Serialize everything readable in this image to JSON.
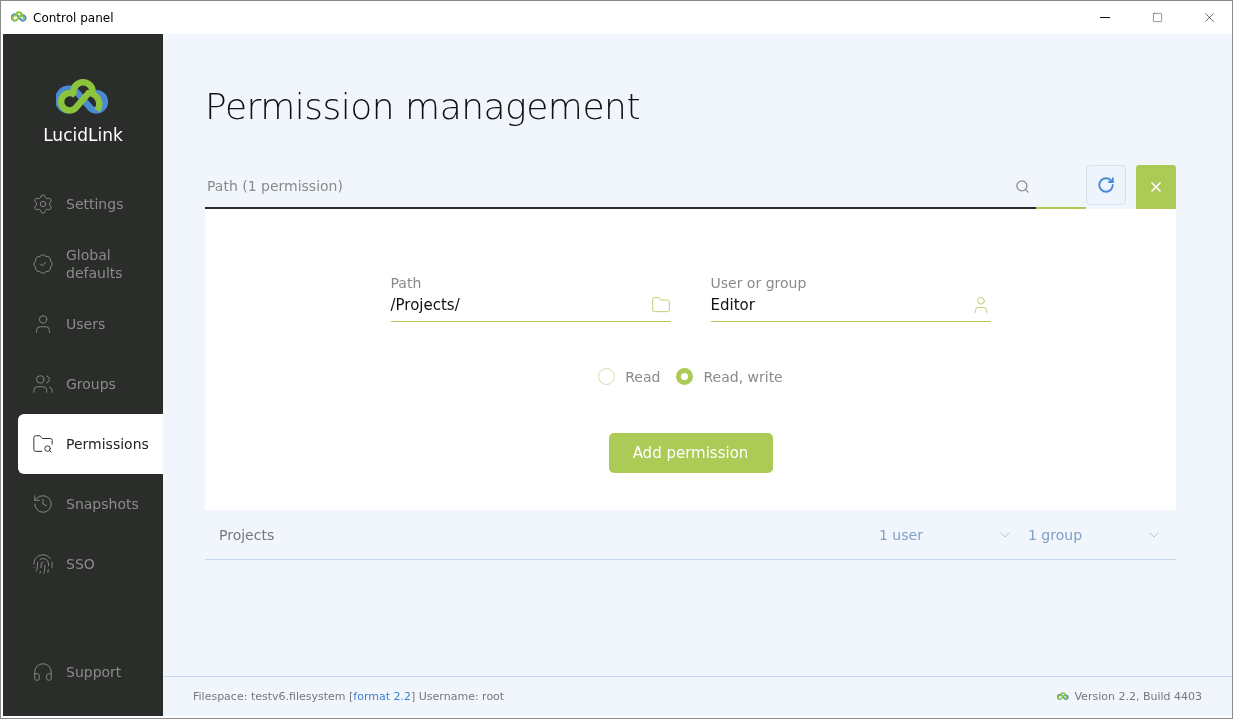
{
  "window": {
    "title": "Control panel"
  },
  "sidebar": {
    "brand": "LucidLink",
    "items": [
      {
        "label": "Settings",
        "selected": false
      },
      {
        "label": "Global defaults",
        "selected": false
      },
      {
        "label": "Users",
        "selected": false
      },
      {
        "label": "Groups",
        "selected": false
      },
      {
        "label": "Permissions",
        "selected": true
      },
      {
        "label": "Snapshots",
        "selected": false
      },
      {
        "label": "SSO",
        "selected": false
      }
    ],
    "support": "Support"
  },
  "page": {
    "title": "Permission management"
  },
  "search": {
    "placeholder": "Path (1 permission)"
  },
  "form": {
    "path": {
      "label": "Path",
      "value": "/Projects/"
    },
    "user": {
      "label": "User or group",
      "value": "Editor"
    },
    "access": [
      {
        "label": "Read",
        "selected": false
      },
      {
        "label": "Read, write",
        "selected": true
      }
    ],
    "submit": "Add permission"
  },
  "permissions": [
    {
      "path": "Projects",
      "users": "1 user",
      "groups": "1 group"
    }
  ],
  "status_bar": {
    "prefix": "Filespace: testv6.filesystem [",
    "link": "format 2.2",
    "suffix": "] Username: root",
    "version": "Version 2.2, Build 4403"
  }
}
